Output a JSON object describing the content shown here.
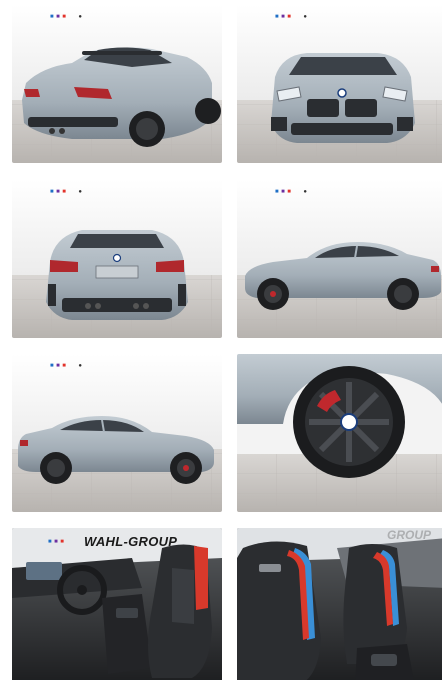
{
  "gallery": {
    "tiles": [
      {
        "view": "rear-three-quarter"
      },
      {
        "view": "front"
      },
      {
        "view": "rear"
      },
      {
        "view": "side-right"
      },
      {
        "view": "side-left"
      },
      {
        "view": "wheel-detail"
      },
      {
        "view": "interior-front-seats",
        "dealer_watermark": "WAHL-GROUP"
      },
      {
        "view": "interior-seats-detail",
        "dealer_watermark": "GROUP"
      }
    ]
  },
  "colors": {
    "car_paint": "#a9b4bd",
    "car_shadow": "#7f8a93",
    "tail_light": "#b0282d",
    "grille": "#2a2d31",
    "studio_wall": "#f4f4f4",
    "floor": "#c9c6c3",
    "seat_leather": "#2b2d30",
    "seat_stripe_red": "#d8392b",
    "seat_stripe_blue": "#3a8fd6"
  }
}
